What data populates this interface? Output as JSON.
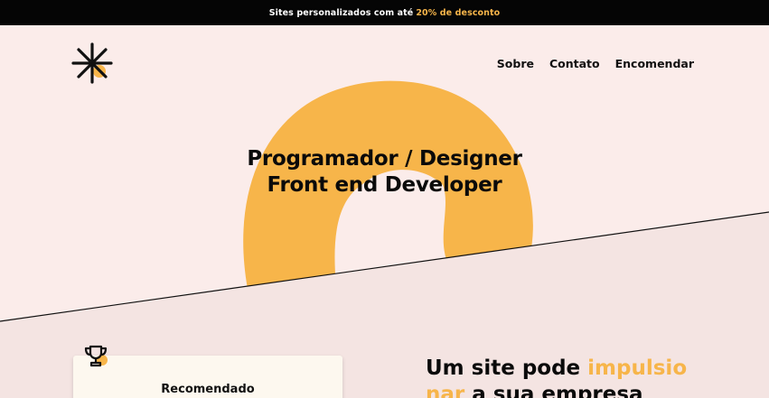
{
  "promo": {
    "text": "Sites personalizados com até",
    "highlight": "20% de desconto"
  },
  "header": {
    "logo_icon": "asterisk-logo-icon",
    "nav": [
      {
        "label": "Sobre"
      },
      {
        "label": "Contato"
      },
      {
        "label": "Encomendar"
      }
    ]
  },
  "hero": {
    "title_line1": "Programador / Designer",
    "title_line2": "Front end Developer"
  },
  "section": {
    "card_icon": "trophy-icon",
    "card_title": "Recomendado",
    "headline_part1": "Um site pode ",
    "headline_highlight": "impulsio nar",
    "headline_part2": " a sua empresa"
  },
  "colors": {
    "background": "#fbecea",
    "lower_background": "#f4e4e2",
    "accent": "#f7b54a",
    "promo_bar": "#050505"
  }
}
